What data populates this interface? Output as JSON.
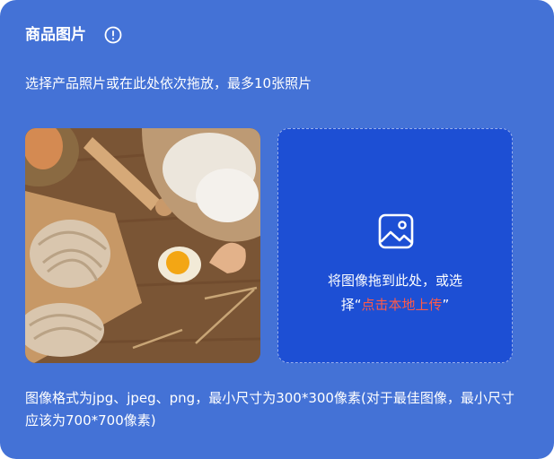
{
  "section": {
    "title": "商品图片",
    "info_icon": "info-circle-icon",
    "instruction": "选择产品照片或在此处依次拖放，最多10张照片"
  },
  "uploaded_image": {
    "description_icon": "food-photo-thumbnail"
  },
  "dropzone": {
    "icon": "image-icon",
    "line1": "将图像拖到此处，或选",
    "line2_prefix": "择“",
    "link_label": "点击本地上传",
    "line2_suffix": "”"
  },
  "footer": {
    "format_note": "图像格式为jpg、jpeg、png，最小尺寸为300*300像素(对于最佳图像，最小尺寸应该为700*700像素)"
  },
  "colors": {
    "card_background": "#4472d6",
    "dropzone_background": "#1d4fd4",
    "link_color": "#ff5a48",
    "text_color": "#ffffff"
  }
}
